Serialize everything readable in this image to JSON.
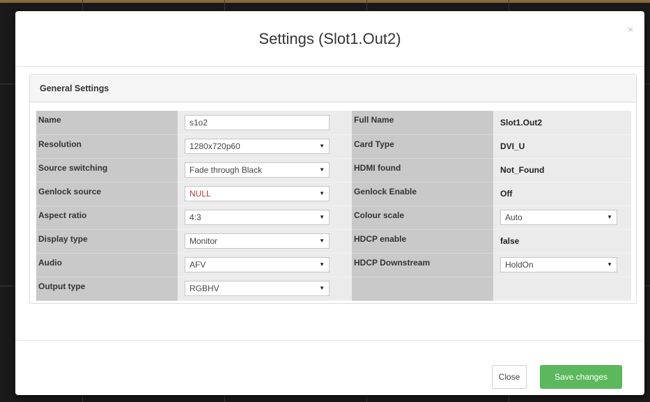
{
  "modal": {
    "title": "Settings (Slot1.Out2)",
    "close_icon": "×"
  },
  "panel": {
    "heading": "General Settings"
  },
  "rows": [
    {
      "left_label": "Name",
      "left_value": "s1o2",
      "left_type": "input",
      "right_label": "Full Name",
      "right_value": "Slot1.Out2",
      "right_type": "text"
    },
    {
      "left_label": "Resolution",
      "left_value": "1280x720p60",
      "left_type": "select",
      "right_label": "Card Type",
      "right_value": "DVI_U",
      "right_type": "text"
    },
    {
      "left_label": "Source switching",
      "left_value": "Fade through Black",
      "left_type": "select",
      "right_label": "HDMI found",
      "right_value": "Not_Found",
      "right_type": "text"
    },
    {
      "left_label": "Genlock source",
      "left_value": "NULL",
      "left_type": "select",
      "right_label": "Genlock Enable",
      "right_value": "Off",
      "right_type": "text"
    },
    {
      "left_label": "Aspect ratio",
      "left_value": "4:3",
      "left_type": "select",
      "right_label": "Colour scale",
      "right_value": "Auto",
      "right_type": "select"
    },
    {
      "left_label": "Display type",
      "left_value": "Monitor",
      "left_type": "select",
      "right_label": "HDCP enable",
      "right_value": "false",
      "right_type": "text"
    },
    {
      "left_label": "Audio",
      "left_value": "AFV",
      "left_type": "select",
      "right_label": "HDCP Downstream",
      "right_value": "HoldOn",
      "right_type": "select"
    },
    {
      "left_label": "Output type",
      "left_value": "RGBHV",
      "left_type": "select",
      "right_label": "",
      "right_value": "",
      "right_type": "empty"
    }
  ],
  "select_arrow": "▼",
  "footer": {
    "close_label": "Close",
    "save_label": "Save changes"
  },
  "colors": {
    "save_button": "#5cb85c",
    "label_cell": "#c9c9c9",
    "value_cell": "#ebebeb"
  }
}
